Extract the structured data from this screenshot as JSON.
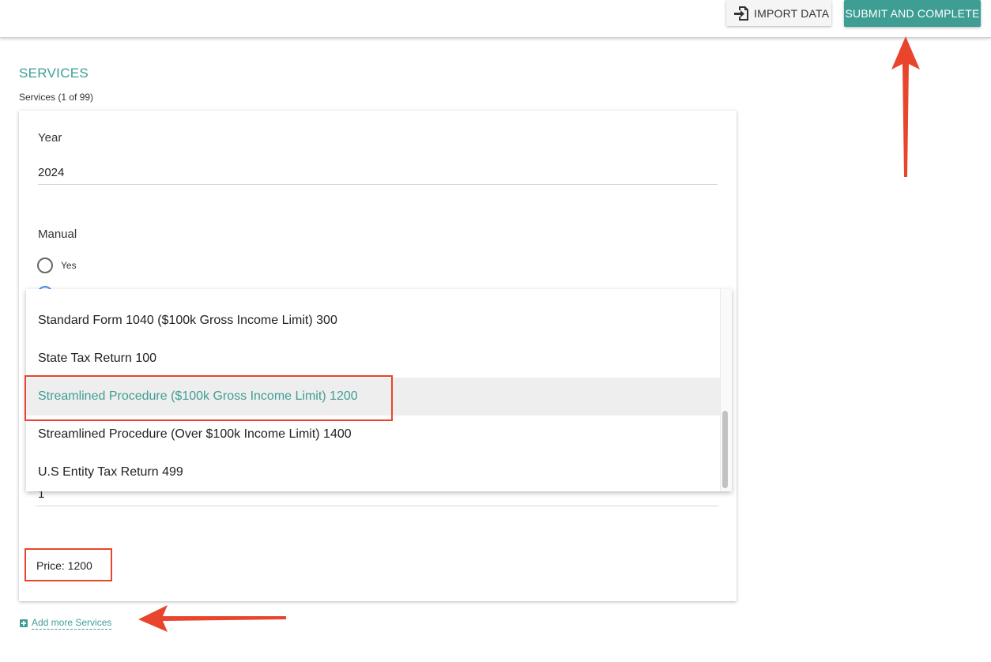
{
  "toolbar": {
    "import_label": "IMPORT DATA",
    "submit_label": "SUBMIT AND COMPLETE"
  },
  "section": {
    "title": "SERVICES",
    "subtitle": "Services (1 of 99)"
  },
  "form": {
    "year_label": "Year",
    "year_value": "2024",
    "manual_label": "Manual",
    "manual_options": [
      "Yes"
    ],
    "quantity_value": "1",
    "price_text": "Price: 1200"
  },
  "dropdown": {
    "items": [
      "Standard Form 1040 ($100k Gross Income Limit) 300",
      "State Tax Return 100",
      "Streamlined Procedure ($100k Gross Income Limit) 1200",
      "Streamlined Procedure (Over $100k Income Limit) 1400",
      "U.S Entity Tax Return 499"
    ],
    "selected_index": 2
  },
  "add_more_label": "Add more Services",
  "icons": {
    "import": "import-icon",
    "add": "plus-square-icon"
  },
  "colors": {
    "accent": "#3f9e94",
    "annotation": "#e8452c"
  }
}
